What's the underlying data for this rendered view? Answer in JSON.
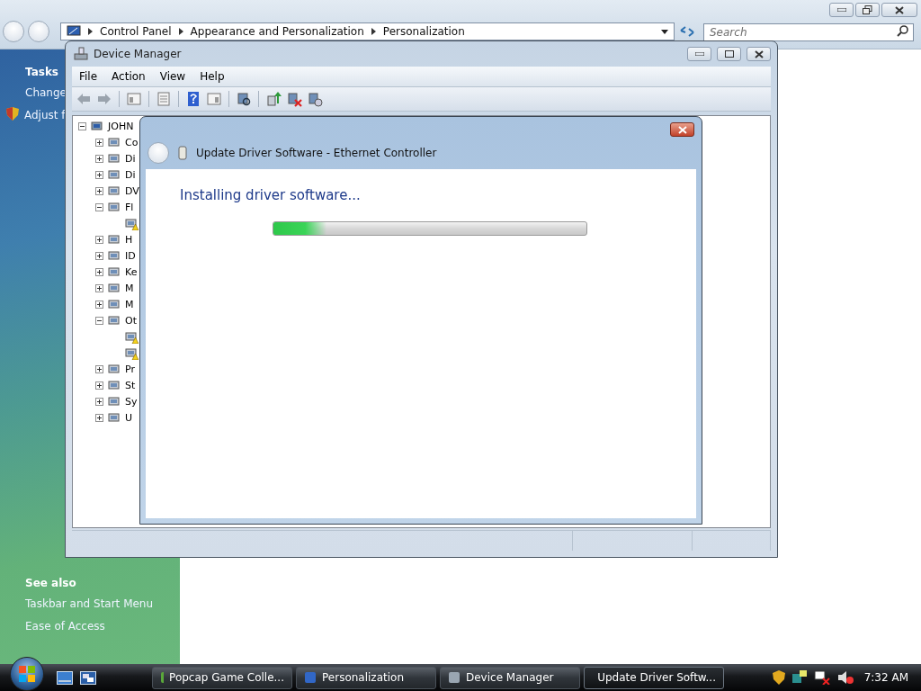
{
  "explorer": {
    "crumbs": [
      "Control Panel",
      "Appearance and Personalization",
      "Personalization"
    ],
    "search": {
      "placeholder": "Search"
    },
    "sidebar": {
      "tasks_heading": "Tasks",
      "tasks": [
        {
          "label": "Change",
          "kind": "link"
        },
        {
          "label": "Adjust f",
          "kind": "shield"
        }
      ],
      "see_also_heading": "See also",
      "see_also": [
        "Taskbar and Start Menu",
        "Ease of Access"
      ]
    }
  },
  "device_manager": {
    "title": "Device Manager",
    "menu": [
      "File",
      "Action",
      "View",
      "Help"
    ],
    "tree": {
      "label": "JOHN",
      "expanded": true,
      "children": [
        {
          "label": "Co",
          "expanded": false
        },
        {
          "label": "Di",
          "expanded": false
        },
        {
          "label": "Di",
          "expanded": false
        },
        {
          "label": "DV",
          "expanded": false
        },
        {
          "label": "Fl",
          "expanded": true,
          "children": [
            {
              "warning": true
            }
          ]
        },
        {
          "label": "H",
          "expanded": false
        },
        {
          "label": "ID",
          "expanded": false
        },
        {
          "label": "Ke",
          "expanded": false
        },
        {
          "label": "M",
          "expanded": false
        },
        {
          "label": "M",
          "expanded": false
        },
        {
          "label": "Ot",
          "expanded": true,
          "children": [
            {
              "warning": true
            },
            {
              "warning": true
            }
          ]
        },
        {
          "label": "Pr",
          "expanded": false
        },
        {
          "label": "St",
          "expanded": false
        },
        {
          "label": "Sy",
          "expanded": false
        },
        {
          "label": "U",
          "expanded": false
        }
      ]
    }
  },
  "dialog": {
    "title": "Update Driver Software - Ethernet Controller",
    "heading": "Installing driver software...",
    "progress": {
      "level": 0.17
    }
  },
  "taskbar": {
    "tasks": [
      {
        "label": "Popcap Game Colle...",
        "selected": false
      },
      {
        "label": "Personalization",
        "selected": false
      },
      {
        "label": "Device Manager",
        "selected": false
      },
      {
        "label": "Update Driver Softw...",
        "selected": true
      }
    ],
    "clock": "7:32 AM"
  }
}
